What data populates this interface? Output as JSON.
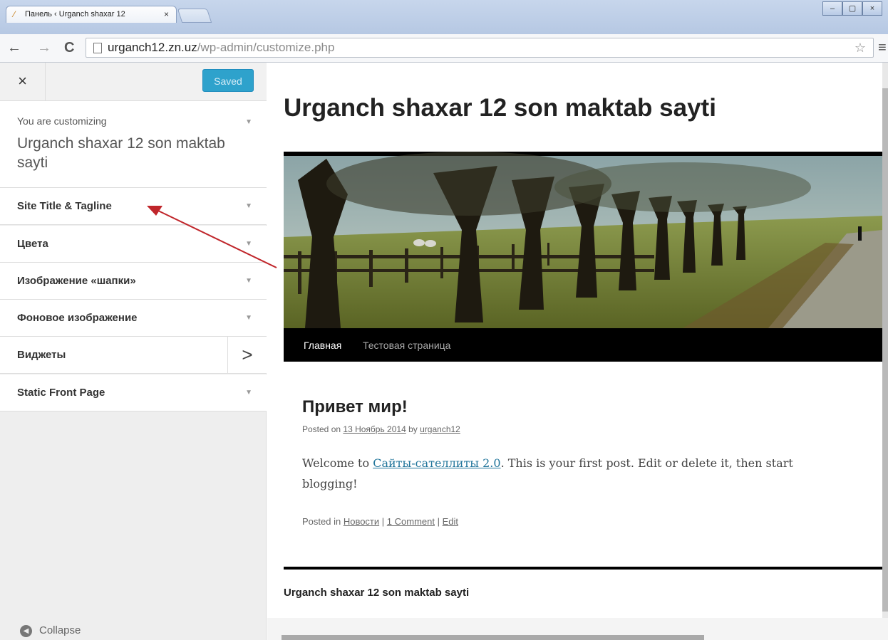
{
  "browser": {
    "tab_title": "Панель ‹ Urganch shaxar 12",
    "tab_close": "×",
    "url_host": "urganch12.zn.uz",
    "url_path": "/wp-admin/customize.php",
    "back_icon": "←",
    "forward_icon": "→",
    "reload_icon": "C",
    "star_icon": "☆",
    "menu_icon": "≡",
    "window_buttons": [
      "–",
      "▢",
      "×"
    ]
  },
  "customizer": {
    "close_label": "×",
    "saved_label": "Saved",
    "customizing_label": "You are customizing",
    "site_name": "Urganch shaxar 12 son maktab sayti",
    "sections": [
      {
        "label": "Site Title & Tagline",
        "indicator": "▼"
      },
      {
        "label": "Цвета",
        "indicator": "▼"
      },
      {
        "label": "Изображение «шапки»",
        "indicator": "▼"
      },
      {
        "label": "Фоновое изображение",
        "indicator": "▼"
      },
      {
        "label": "Виджеты",
        "indicator": ">"
      },
      {
        "label": "Static Front Page",
        "indicator": "▼"
      }
    ],
    "collapse_label": "Collapse"
  },
  "preview": {
    "site_title": "Urganch shaxar 12 son maktab sayti",
    "menu": [
      "Главная",
      "Тестовая страница"
    ],
    "post": {
      "title": "Привет мир!",
      "posted_on": "Posted on",
      "date": "13 Ноябрь 2014",
      "by": "by",
      "author": "urganch12",
      "body_before": "Welcome to",
      "body_link": "Сайты-сателлиты 2.0",
      "body_after": ". This is your first post. Edit or delete it, then start blogging!",
      "posted_in": "Posted in",
      "category": "Новости",
      "sep": "|",
      "comments": "1 Comment",
      "edit": "Edit"
    },
    "footer": "Urganch shaxar 12 son maktab sayti"
  },
  "colors": {
    "saved_button": "#2ea2cc",
    "annotation_arrow": "#c0262b",
    "link": "#21759b"
  }
}
